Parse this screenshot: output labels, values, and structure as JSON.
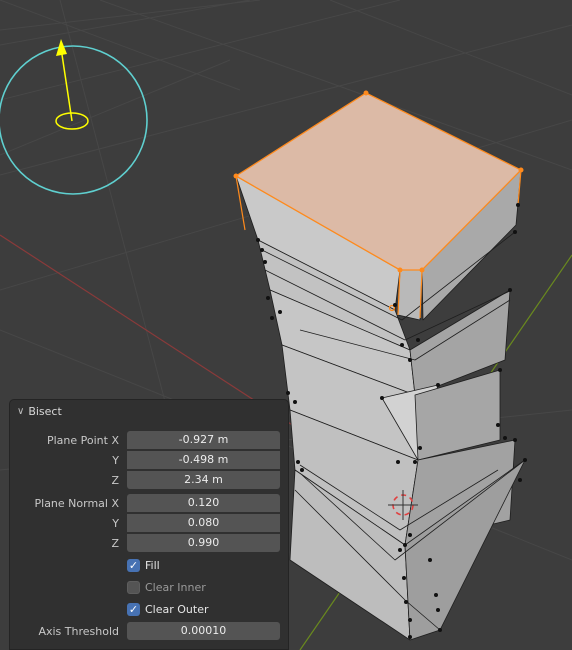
{
  "panel": {
    "title": "Bisect",
    "plane_point": {
      "label_x": "Plane Point X",
      "label_y": "Y",
      "label_z": "Z",
      "x": "-0.927 m",
      "y": "-0.498 m",
      "z": "2.34 m"
    },
    "plane_normal": {
      "label_x": "Plane Normal X",
      "label_y": "Y",
      "label_z": "Z",
      "x": "0.120",
      "y": "0.080",
      "z": "0.990"
    },
    "fill": {
      "label": "Fill",
      "checked": true
    },
    "clear_inner": {
      "label": "Clear Inner",
      "checked": false
    },
    "clear_outer": {
      "label": "Clear Outer",
      "checked": true
    },
    "axis_threshold": {
      "label": "Axis Threshold",
      "value": "0.00010"
    }
  },
  "colors": {
    "background": "#3d3d3d",
    "selection_orange": "#ff8a1c",
    "axis_red": "#8a3a3a",
    "axis_green": "#6a8a1e",
    "gizmo_cyan": "#5fd0d0",
    "gizmo_yellow": "#ffff00"
  }
}
